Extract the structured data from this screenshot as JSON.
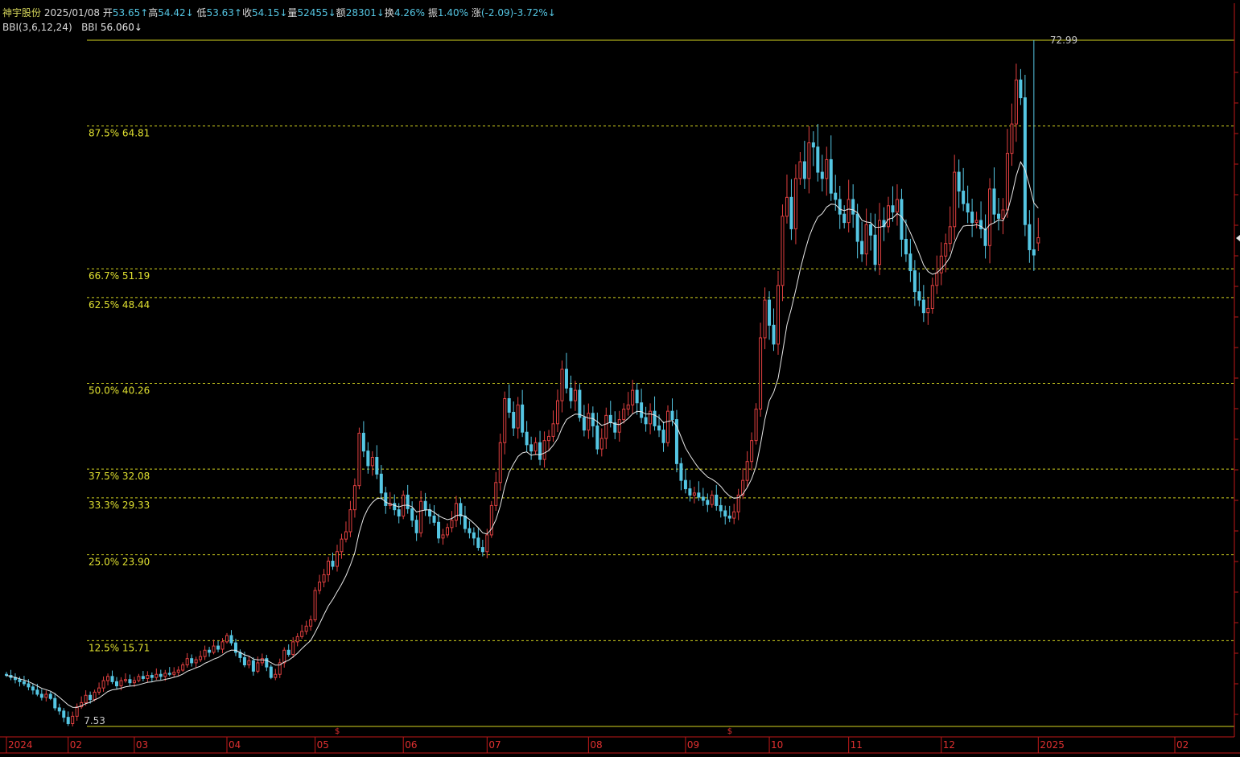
{
  "header": {
    "stock_name": "神宇股份",
    "date": "2025/01/08",
    "open_label": "开",
    "open_value": "53.65↑",
    "high_label": "高",
    "high_value": "54.42↓",
    "low_label": "低",
    "low_value": "53.63↑",
    "close_label": "收",
    "close_value": "54.15↓",
    "volume_label": "量",
    "volume_value": "52455↓",
    "amount_label": "额",
    "amount_value": "28301↓",
    "turnover_label": "换",
    "turnover_value": "4.26%",
    "amplitude_label": "振",
    "amplitude_value": "1.40%",
    "change_label": "涨",
    "change_value": "(-2.09)-3.72%↓",
    "indicator_name": "BBI(3,6,12,24)",
    "indicator_value_label": "BBI",
    "indicator_value": "56.060↓"
  },
  "colors": {
    "background": "#000000",
    "up_candle": "#e04040",
    "down_candle": "#55c6e3",
    "bbi_line": "#e8e8e8",
    "fib_line": "#d4d420",
    "fib_text": "#e0e030",
    "axis": "#c01818",
    "axis_text": "#e03030",
    "extreme_text": "#c8c8c8"
  },
  "chart_data": {
    "type": "candlestick",
    "x": [
      "01/12",
      "01/15",
      "01/16",
      "01/17",
      "01/18",
      "01/19",
      "01/22",
      "01/23",
      "01/24",
      "01/25",
      "01/26",
      "01/29",
      "01/30",
      "01/31",
      "02/01",
      "02/02",
      "02/05",
      "02/06",
      "02/07",
      "02/08",
      "02/19",
      "02/20",
      "02/21",
      "02/22",
      "02/23",
      "02/26",
      "02/27",
      "02/28",
      "02/29",
      "03/01",
      "03/04",
      "03/05",
      "03/06",
      "03/07",
      "03/08",
      "03/11",
      "03/12",
      "03/13",
      "03/14",
      "03/15",
      "03/18",
      "03/19",
      "03/20",
      "03/21",
      "03/22",
      "03/25",
      "03/26",
      "03/27",
      "03/28",
      "03/29",
      "04/01",
      "04/02",
      "04/03",
      "04/08",
      "04/09",
      "04/10",
      "04/11",
      "04/12",
      "04/15",
      "04/16",
      "04/17",
      "04/18",
      "04/19",
      "04/22",
      "04/23",
      "04/24",
      "04/25",
      "04/26",
      "04/29",
      "04/30",
      "05/06",
      "05/07",
      "05/08",
      "05/09",
      "05/10",
      "05/13",
      "05/14",
      "05/15",
      "05/16",
      "05/17",
      "05/20",
      "05/21",
      "05/22",
      "05/23",
      "05/24",
      "05/27",
      "05/28",
      "05/29",
      "05/30",
      "05/31",
      "06/03",
      "06/04",
      "06/05",
      "06/06",
      "06/07",
      "06/11",
      "06/12",
      "06/13",
      "06/14",
      "06/17",
      "06/18",
      "06/19",
      "06/20",
      "06/21",
      "06/24",
      "06/25",
      "06/26",
      "06/27",
      "06/28",
      "07/01",
      "07/02",
      "07/03",
      "07/04",
      "07/05",
      "07/08",
      "07/09",
      "07/10",
      "07/11",
      "07/12",
      "07/15",
      "07/16",
      "07/17",
      "07/18",
      "07/19",
      "07/22",
      "07/23",
      "07/24",
      "07/25",
      "07/26",
      "07/29",
      "07/30",
      "07/31",
      "08/01",
      "08/02",
      "08/05",
      "08/06",
      "08/07",
      "08/08",
      "08/09",
      "08/12",
      "08/13",
      "08/14",
      "08/15",
      "08/16",
      "08/19",
      "08/20",
      "08/21",
      "08/22",
      "08/23",
      "08/26",
      "08/27",
      "08/28",
      "08/29",
      "08/30",
      "09/02",
      "09/03",
      "09/04",
      "09/05",
      "09/06",
      "09/09",
      "09/10",
      "09/11",
      "09/12",
      "09/13",
      "09/18",
      "09/19",
      "09/20",
      "09/23",
      "09/24",
      "09/25",
      "09/26",
      "09/27",
      "09/30",
      "10/08",
      "10/09",
      "10/10",
      "10/11",
      "10/14",
      "10/15",
      "10/16",
      "10/17",
      "10/18",
      "10/21",
      "10/22",
      "10/23",
      "10/24",
      "10/25",
      "10/28",
      "10/29",
      "10/30",
      "10/31",
      "11/01",
      "11/04",
      "11/05",
      "11/06",
      "11/07",
      "11/08",
      "11/11",
      "11/12",
      "11/13",
      "11/14",
      "11/15",
      "11/18",
      "11/19",
      "11/20",
      "11/21",
      "11/22",
      "11/25",
      "11/26",
      "11/27",
      "11/28",
      "11/29",
      "12/02",
      "12/03",
      "12/04",
      "12/05",
      "12/06",
      "12/09",
      "12/10",
      "12/11",
      "12/12",
      "12/13",
      "12/16",
      "12/17",
      "12/18",
      "12/19",
      "12/20",
      "12/23",
      "12/24",
      "12/25",
      "12/26",
      "12/27",
      "12/30",
      "12/31",
      "01/02",
      "01/03",
      "01/06",
      "01/07",
      "01/08"
    ],
    "close": [
      12.4,
      12.2,
      12.0,
      11.8,
      11.6,
      11.3,
      11.0,
      10.6,
      10.3,
      10.6,
      10.2,
      9.3,
      9.0,
      8.4,
      7.8,
      8.5,
      9.4,
      9.8,
      10.5,
      10.1,
      10.8,
      11.2,
      11.9,
      12.3,
      11.8,
      11.4,
      11.9,
      12.0,
      11.7,
      11.9,
      12.3,
      12.1,
      12.4,
      12.2,
      12.5,
      12.3,
      12.6,
      12.5,
      12.7,
      12.9,
      13.4,
      14.0,
      13.6,
      13.9,
      14.2,
      14.8,
      14.6,
      15.2,
      14.9,
      15.6,
      16.2,
      15.5,
      14.6,
      14.1,
      13.4,
      13.8,
      12.8,
      13.6,
      14.0,
      13.2,
      12.2,
      12.5,
      13.6,
      14.8,
      14.4,
      15.6,
      16.1,
      16.6,
      17.1,
      17.7,
      20.5,
      21.3,
      22.0,
      23.3,
      22.8,
      24.2,
      25.4,
      26.1,
      28.2,
      30.5,
      35.5,
      33.8,
      32.4,
      33.2,
      31.6,
      29.8,
      28.6,
      28.8,
      28.2,
      27.6,
      29.6,
      28.3,
      27.2,
      26.0,
      29.0,
      28.2,
      27.6,
      27.0,
      25.5,
      25.8,
      26.5,
      27.2,
      28.8,
      27.6,
      26.4,
      26.0,
      25.5,
      24.6,
      24.2,
      25.8,
      28.6,
      30.8,
      34.6,
      38.8,
      37.5,
      36.0,
      38.2,
      35.6,
      34.4,
      33.8,
      34.6,
      33.0,
      34.8,
      35.2,
      36.4,
      38.6,
      41.6,
      39.8,
      38.6,
      39.6,
      37.0,
      35.8,
      37.4,
      36.2,
      34.0,
      35.0,
      37.2,
      36.5,
      35.6,
      36.8,
      37.8,
      38.2,
      39.6,
      38.4,
      37.0,
      36.4,
      37.6,
      36.2,
      35.8,
      34.6,
      37.6,
      36.8,
      32.6,
      31.0,
      30.2,
      29.6,
      29.8,
      29.4,
      29.1,
      28.7,
      29.6,
      28.6,
      28.1,
      27.6,
      27.4,
      28.0,
      29.6,
      31.0,
      32.8,
      34.8,
      37.8,
      44.6,
      48.2,
      45.8,
      44.0,
      49.6,
      56.2,
      58.0,
      55.0,
      59.8,
      61.4,
      59.8,
      63.2,
      62.8,
      60.4,
      59.8,
      61.6,
      58.4,
      57.8,
      56.4,
      55.6,
      57.8,
      56.4,
      53.8,
      52.6,
      55.4,
      54.4,
      51.6,
      55.8,
      55.2,
      57.2,
      56.6,
      57.8,
      54.0,
      52.6,
      51.0,
      49.0,
      48.2,
      47.0,
      47.4,
      49.6,
      50.8,
      52.4,
      53.6,
      55.2,
      60.4,
      58.6,
      57.4,
      56.6,
      55.6,
      55.8,
      55.0,
      53.4,
      58.8,
      56.4,
      56.0,
      56.8,
      62.2,
      65.0,
      69.2,
      67.5,
      55.4,
      53.0,
      52.5,
      54.15
    ],
    "open": [
      12.5,
      12.4,
      12.2,
      12.0,
      11.8,
      11.6,
      11.3,
      11.0,
      10.6,
      10.3,
      10.6,
      10.2,
      9.3,
      9.0,
      8.4,
      7.8,
      8.5,
      9.4,
      9.8,
      10.5,
      10.1,
      10.8,
      11.2,
      11.9,
      12.3,
      11.8,
      11.4,
      11.9,
      12.0,
      11.7,
      11.9,
      12.3,
      12.1,
      12.4,
      12.2,
      12.5,
      12.3,
      12.6,
      12.5,
      12.7,
      12.9,
      13.4,
      14.0,
      13.6,
      13.9,
      14.2,
      14.8,
      14.6,
      15.2,
      14.9,
      15.6,
      16.2,
      15.5,
      14.6,
      14.1,
      13.4,
      13.8,
      12.8,
      13.6,
      14.0,
      13.2,
      12.2,
      12.5,
      13.6,
      14.8,
      14.4,
      15.6,
      16.1,
      16.6,
      17.1,
      17.7,
      20.5,
      21.3,
      22.0,
      23.3,
      22.8,
      24.2,
      25.4,
      26.1,
      28.2,
      30.5,
      35.5,
      33.8,
      32.4,
      33.2,
      31.6,
      29.8,
      28.6,
      28.8,
      28.2,
      27.6,
      29.6,
      28.3,
      27.2,
      26.0,
      29.0,
      28.2,
      27.6,
      27.0,
      25.5,
      25.8,
      26.5,
      27.2,
      28.8,
      27.6,
      26.4,
      26.0,
      25.5,
      24.6,
      24.2,
      25.8,
      28.6,
      30.8,
      34.6,
      38.8,
      37.5,
      36.0,
      38.2,
      35.6,
      34.4,
      33.8,
      34.6,
      33.0,
      34.8,
      35.2,
      36.4,
      38.6,
      41.6,
      39.8,
      38.6,
      39.6,
      37.0,
      35.8,
      37.4,
      36.2,
      34.0,
      35.0,
      37.2,
      36.5,
      35.6,
      36.8,
      37.8,
      38.2,
      39.6,
      38.4,
      37.0,
      36.4,
      37.6,
      36.2,
      35.8,
      34.6,
      37.6,
      36.8,
      32.6,
      31.0,
      30.2,
      29.6,
      29.8,
      29.4,
      29.1,
      28.7,
      29.6,
      28.6,
      28.1,
      27.6,
      27.4,
      28.0,
      29.6,
      31.0,
      32.8,
      34.8,
      37.8,
      44.6,
      48.2,
      45.8,
      44.0,
      49.6,
      56.2,
      58.0,
      55.0,
      59.8,
      61.4,
      59.8,
      63.2,
      62.8,
      60.4,
      59.8,
      61.6,
      58.4,
      57.8,
      56.4,
      55.6,
      57.8,
      56.4,
      53.8,
      52.6,
      55.4,
      54.4,
      51.6,
      55.8,
      55.2,
      57.2,
      56.6,
      57.8,
      54.0,
      52.6,
      51.0,
      49.0,
      48.2,
      47.0,
      47.4,
      49.6,
      50.8,
      52.4,
      53.6,
      55.2,
      60.4,
      58.6,
      57.4,
      56.6,
      55.6,
      55.8,
      55.0,
      53.4,
      58.8,
      56.4,
      56.0,
      56.8,
      62.2,
      65.0,
      69.2,
      67.5,
      55.4,
      53.0,
      53.65
    ],
    "high_at": {
      "x": "12/31",
      "value": 72.99
    },
    "low_at": {
      "x": "02/02",
      "value": 7.53
    },
    "fib_levels": [
      {
        "label": "87.5% 64.81",
        "value": 64.81
      },
      {
        "label": "66.7% 51.19",
        "value": 51.19
      },
      {
        "label": "62.5% 48.44",
        "value": 48.44
      },
      {
        "label": "50.0% 40.26",
        "value": 40.26
      },
      {
        "label": "37.5% 32.08",
        "value": 32.08
      },
      {
        "label": "33.3% 29.33",
        "value": 29.33
      },
      {
        "label": "25.0% 23.90",
        "value": 23.9
      },
      {
        "label": "12.5% 15.71",
        "value": 15.71
      }
    ],
    "high_label": "72.99",
    "low_label": "7.53",
    "month_ticks": [
      {
        "label": "2024",
        "x": "01/12"
      },
      {
        "label": "02",
        "x": "02/01"
      },
      {
        "label": "03",
        "x": "03/01"
      },
      {
        "label": "04",
        "x": "04/01"
      },
      {
        "label": "05",
        "x": "05/06"
      },
      {
        "label": "06",
        "x": "06/03"
      },
      {
        "label": "07",
        "x": "07/01"
      },
      {
        "label": "08",
        "x": "08/01"
      },
      {
        "label": "09",
        "x": "09/02"
      },
      {
        "label": "10",
        "x": "10/08"
      },
      {
        "label": "11",
        "x": "11/01"
      },
      {
        "label": "12",
        "x": "12/02"
      },
      {
        "label": "2025",
        "x": "01/02"
      },
      {
        "label": "02",
        "x": ""
      }
    ],
    "event_markers": [
      {
        "label": "$",
        "x": "05/13"
      },
      {
        "label": "$",
        "x": "09/18"
      }
    ],
    "ylim": [
      7.53,
      72.99
    ]
  }
}
